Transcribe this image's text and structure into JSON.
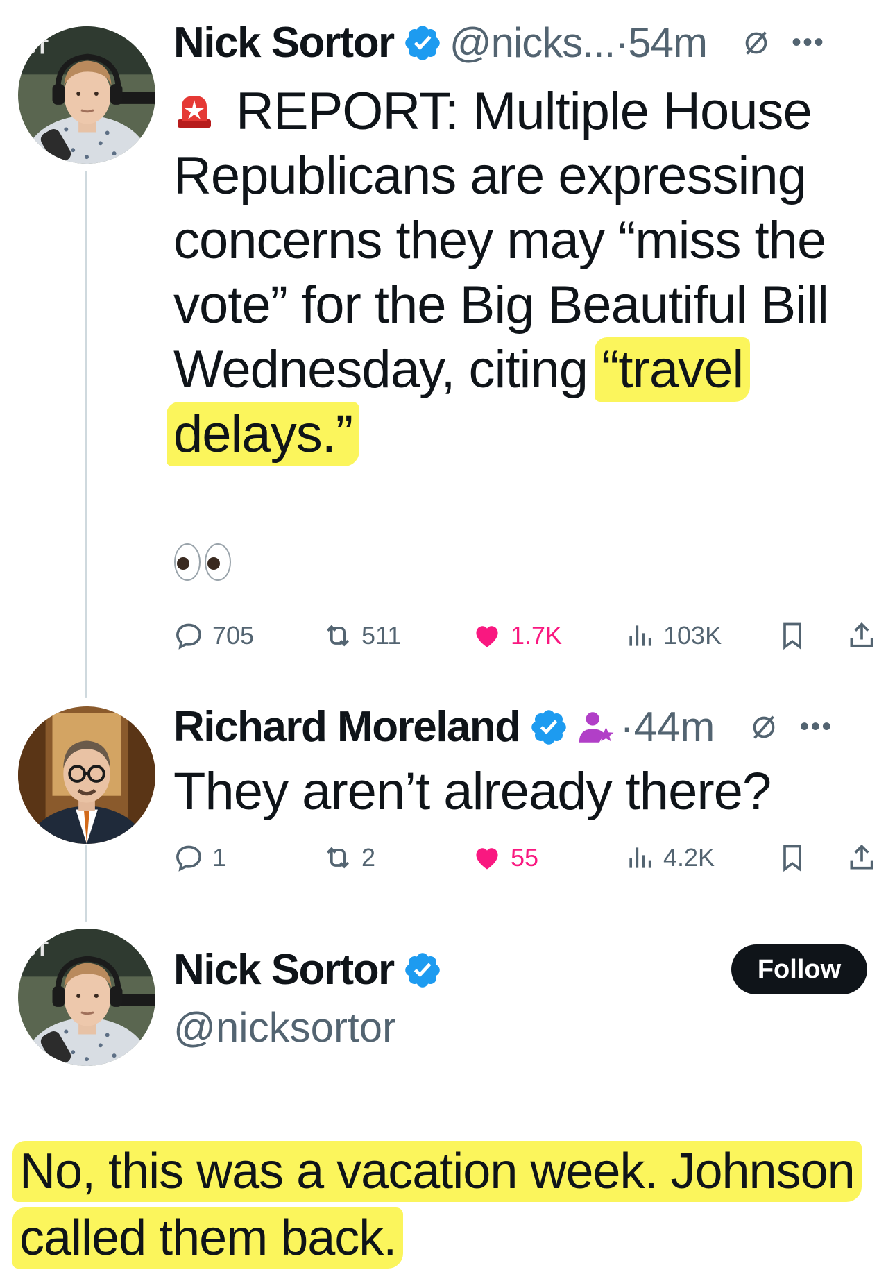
{
  "tweet1": {
    "name": "Nick Sortor",
    "handle_time": "@nicks...·54m",
    "siren_label": "🚨",
    "text_pre": "REPORT: Multiple House Republicans are expressing concerns they may “miss the vote” for the Big Beautiful Bill Wednesday, citing ",
    "text_highlight": "“travel delays.”",
    "emoji_line": "👀",
    "reply_count": "705",
    "repost_count": "511",
    "like_count": "1.7K",
    "view_count": "103K"
  },
  "tweet2": {
    "name": "Richard Moreland",
    "time": "·44m",
    "text": "They aren’t already there?",
    "reply_count": "1",
    "repost_count": "2",
    "like_count": "55",
    "view_count": "4.2K"
  },
  "profile": {
    "name": "Nick Sortor",
    "handle": "@nicksortor",
    "follow_label": "Follow",
    "reply_text": "No, this was a vacation week. Johnson called them back."
  },
  "colors": {
    "verified": "#1d9bf0",
    "like": "#f91880",
    "highlight": "#fbf55c",
    "muted": "#536471"
  }
}
